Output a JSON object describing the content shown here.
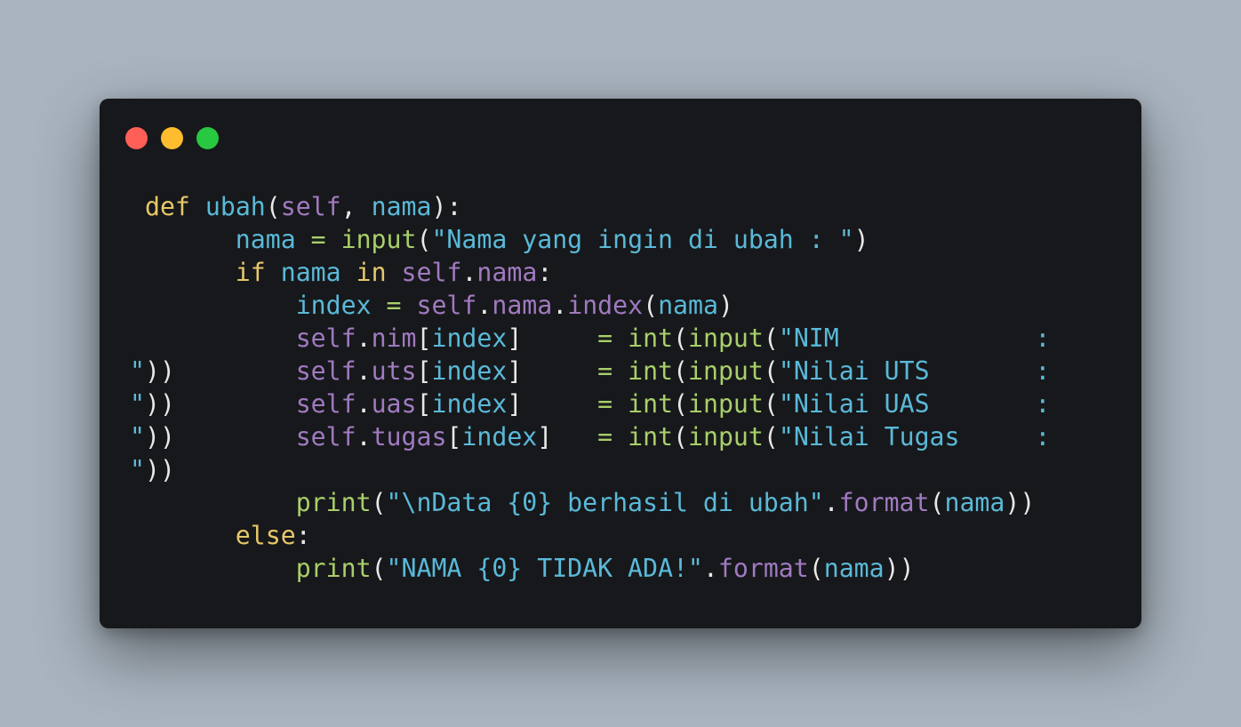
{
  "window": {
    "colors": {
      "background": "#17181b",
      "page_background": "#a9b4bf",
      "close": "#ff5f57",
      "minimize": "#febc2e",
      "maximize": "#28c840"
    },
    "controls": [
      "close",
      "minimize",
      "maximize"
    ]
  },
  "code": {
    "language": "python",
    "lines": [
      [
        [
          "kw",
          " def"
        ],
        [
          "p",
          " "
        ],
        [
          "fn",
          "ubah"
        ],
        [
          "p",
          "("
        ],
        [
          "self",
          "self"
        ],
        [
          "p",
          ", "
        ],
        [
          "var",
          "nama"
        ],
        [
          "p",
          "):"
        ]
      ],
      [
        [
          "p",
          "       "
        ],
        [
          "var",
          "nama"
        ],
        [
          "op",
          " = "
        ],
        [
          "bi",
          "input"
        ],
        [
          "p",
          "("
        ],
        [
          "str",
          "\"Nama yang ingin di ubah : \""
        ],
        [
          "p",
          ")"
        ]
      ],
      [
        [
          "p",
          "       "
        ],
        [
          "kw",
          "if"
        ],
        [
          "p",
          " "
        ],
        [
          "var",
          "nama"
        ],
        [
          "p",
          " "
        ],
        [
          "kw",
          "in"
        ],
        [
          "p",
          " "
        ],
        [
          "self",
          "self"
        ],
        [
          "p",
          "."
        ],
        [
          "attr",
          "nama"
        ],
        [
          "p",
          ":"
        ]
      ],
      [
        [
          "p",
          "           "
        ],
        [
          "var",
          "index"
        ],
        [
          "op",
          " = "
        ],
        [
          "self",
          "self"
        ],
        [
          "p",
          "."
        ],
        [
          "attr",
          "nama"
        ],
        [
          "p",
          "."
        ],
        [
          "attr",
          "index"
        ],
        [
          "p",
          "("
        ],
        [
          "var",
          "nama"
        ],
        [
          "p",
          ")"
        ]
      ],
      [
        [
          "p",
          "           "
        ],
        [
          "self",
          "self"
        ],
        [
          "p",
          "."
        ],
        [
          "attr",
          "nim"
        ],
        [
          "p",
          "["
        ],
        [
          "var",
          "index"
        ],
        [
          "p",
          "]"
        ],
        [
          "op",
          "     = "
        ],
        [
          "bi",
          "int"
        ],
        [
          "p",
          "("
        ],
        [
          "bi",
          "input"
        ],
        [
          "p",
          "("
        ],
        [
          "str",
          "\"NIM             :"
        ]
      ],
      [
        [
          "str",
          "\""
        ],
        [
          "p",
          "))        "
        ],
        [
          "self",
          "self"
        ],
        [
          "p",
          "."
        ],
        [
          "attr",
          "uts"
        ],
        [
          "p",
          "["
        ],
        [
          "var",
          "index"
        ],
        [
          "p",
          "]"
        ],
        [
          "op",
          "     = "
        ],
        [
          "bi",
          "int"
        ],
        [
          "p",
          "("
        ],
        [
          "bi",
          "input"
        ],
        [
          "p",
          "("
        ],
        [
          "str",
          "\"Nilai UTS       :"
        ]
      ],
      [
        [
          "str",
          "\""
        ],
        [
          "p",
          "))        "
        ],
        [
          "self",
          "self"
        ],
        [
          "p",
          "."
        ],
        [
          "attr",
          "uas"
        ],
        [
          "p",
          "["
        ],
        [
          "var",
          "index"
        ],
        [
          "p",
          "]"
        ],
        [
          "op",
          "     = "
        ],
        [
          "bi",
          "int"
        ],
        [
          "p",
          "("
        ],
        [
          "bi",
          "input"
        ],
        [
          "p",
          "("
        ],
        [
          "str",
          "\"Nilai UAS       :"
        ]
      ],
      [
        [
          "str",
          "\""
        ],
        [
          "p",
          "))        "
        ],
        [
          "self",
          "self"
        ],
        [
          "p",
          "."
        ],
        [
          "attr",
          "tugas"
        ],
        [
          "p",
          "["
        ],
        [
          "var",
          "index"
        ],
        [
          "p",
          "]"
        ],
        [
          "op",
          "   = "
        ],
        [
          "bi",
          "int"
        ],
        [
          "p",
          "("
        ],
        [
          "bi",
          "input"
        ],
        [
          "p",
          "("
        ],
        [
          "str",
          "\"Nilai Tugas     :"
        ]
      ],
      [
        [
          "str",
          "\""
        ],
        [
          "p",
          "))"
        ]
      ],
      [
        [
          "p",
          "           "
        ],
        [
          "bi",
          "print"
        ],
        [
          "p",
          "("
        ],
        [
          "str",
          "\"\\nData {0} berhasil di ubah\""
        ],
        [
          "p",
          "."
        ],
        [
          "attr",
          "format"
        ],
        [
          "p",
          "("
        ],
        [
          "var",
          "nama"
        ],
        [
          "p",
          "))"
        ]
      ],
      [
        [
          "p",
          "       "
        ],
        [
          "kw",
          "else"
        ],
        [
          "p",
          ":"
        ]
      ],
      [
        [
          "p",
          "           "
        ],
        [
          "bi",
          "print"
        ],
        [
          "p",
          "("
        ],
        [
          "str",
          "\"NAMA {0} TIDAK ADA!\""
        ],
        [
          "p",
          "."
        ],
        [
          "attr",
          "format"
        ],
        [
          "p",
          "("
        ],
        [
          "var",
          "nama"
        ],
        [
          "p",
          "))"
        ]
      ]
    ]
  }
}
